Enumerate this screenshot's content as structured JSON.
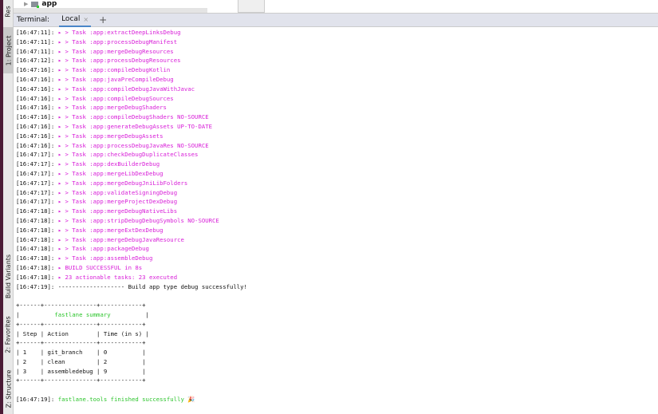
{
  "sidebar": {
    "tabs": [
      "Res",
      "1: Project",
      "Build Variants",
      "2: Favorites",
      "Z: Structure"
    ]
  },
  "project_tree": {
    "item": "app"
  },
  "terminal": {
    "title": "Terminal:",
    "tab": "Local",
    "close": "×",
    "add": "+"
  },
  "log": [
    {
      "t": "[16:47:11]: ",
      "m": "▸ > Task :app:extractDeepLinksDebug"
    },
    {
      "t": "[16:47:11]: ",
      "m": "▸ > Task :app:processDebugManifest"
    },
    {
      "t": "[16:47:11]: ",
      "m": "▸ > Task :app:mergeDebugResources"
    },
    {
      "t": "[16:47:12]: ",
      "m": "▸ > Task :app:processDebugResources"
    },
    {
      "t": "[16:47:16]: ",
      "m": "▸ > Task :app:compileDebugKotlin"
    },
    {
      "t": "[16:47:16]: ",
      "m": "▸ > Task :app:javaPreCompileDebug"
    },
    {
      "t": "[16:47:16]: ",
      "m": "▸ > Task :app:compileDebugJavaWithJavac"
    },
    {
      "t": "[16:47:16]: ",
      "m": "▸ > Task :app:compileDebugSources"
    },
    {
      "t": "[16:47:16]: ",
      "m": "▸ > Task :app:mergeDebugShaders"
    },
    {
      "t": "[16:47:16]: ",
      "m": "▸ > Task :app:compileDebugShaders NO-SOURCE"
    },
    {
      "t": "[16:47:16]: ",
      "m": "▸ > Task :app:generateDebugAssets UP-TO-DATE"
    },
    {
      "t": "[16:47:16]: ",
      "m": "▸ > Task :app:mergeDebugAssets"
    },
    {
      "t": "[16:47:16]: ",
      "m": "▸ > Task :app:processDebugJavaRes NO-SOURCE"
    },
    {
      "t": "[16:47:17]: ",
      "m": "▸ > Task :app:checkDebugDuplicateClasses"
    },
    {
      "t": "[16:47:17]: ",
      "m": "▸ > Task :app:dexBuilderDebug"
    },
    {
      "t": "[16:47:17]: ",
      "m": "▸ > Task :app:mergeLibDexDebug"
    },
    {
      "t": "[16:47:17]: ",
      "m": "▸ > Task :app:mergeDebugJniLibFolders"
    },
    {
      "t": "[16:47:17]: ",
      "m": "▸ > Task :app:validateSigningDebug"
    },
    {
      "t": "[16:47:17]: ",
      "m": "▸ > Task :app:mergeProjectDexDebug"
    },
    {
      "t": "[16:47:18]: ",
      "m": "▸ > Task :app:mergeDebugNativeLibs"
    },
    {
      "t": "[16:47:18]: ",
      "m": "▸ > Task :app:stripDebugDebugSymbols NO-SOURCE"
    },
    {
      "t": "[16:47:18]: ",
      "m": "▸ > Task :app:mergeExtDexDebug"
    },
    {
      "t": "[16:47:18]: ",
      "m": "▸ > Task :app:mergeDebugJavaResource"
    },
    {
      "t": "[16:47:18]: ",
      "m": "▸ > Task :app:packageDebug"
    },
    {
      "t": "[16:47:18]: ",
      "m": "▸ > Task :app:assembleDebug"
    },
    {
      "t": "[16:47:18]: ",
      "m": "▸ BUILD SUCCESSFUL in 8s"
    },
    {
      "t": "[16:47:18]: ",
      "m": "▸ 23 actionable tasks: 23 executed"
    }
  ],
  "build_line": {
    "t": "[16:47:19]: ",
    "m": "------------------- Build app type debug successfully!"
  },
  "summary": {
    "border": "+------+---------------+------------+",
    "title_pre": "|          ",
    "title": "fastlane summary",
    "title_post": "          |",
    "header": "| Step | Action        | Time (in s) |",
    "rows": [
      "| 1    | git_branch    | 0          |",
      "| 2    | clean         | 2          |",
      "| 3    | assembledebug | 9          |"
    ]
  },
  "final": {
    "t": "[16:47:19]: ",
    "m": "fastlane.tools finished successfully 🎉"
  }
}
